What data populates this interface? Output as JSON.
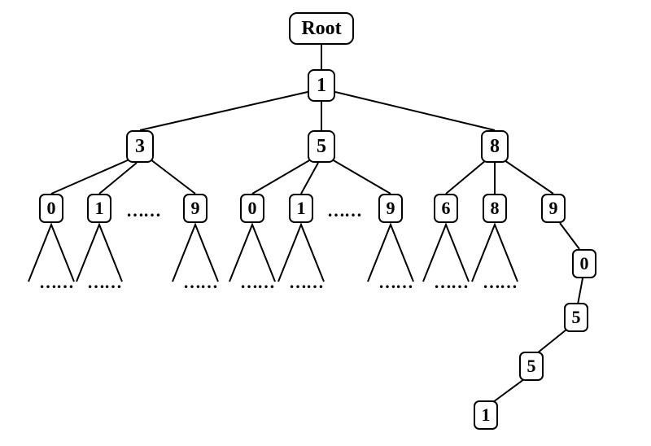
{
  "tree": {
    "root": "Root",
    "l1": {
      "n1": "1"
    },
    "l2": {
      "n3": "3",
      "n5": "5",
      "n8": "8"
    },
    "l3": {
      "a": {
        "c0": "0",
        "c1": "1",
        "c9": "9"
      },
      "b": {
        "c0": "0",
        "c1": "1",
        "c9": "9"
      },
      "c": {
        "c6": "6",
        "c8": "8",
        "c9": "9"
      }
    },
    "tail": {
      "t0": "0",
      "t5a": "5",
      "t5b": "5",
      "t1": "1"
    }
  },
  "dots": "……",
  "chart_data": {
    "type": "tree",
    "title": "",
    "description": "digit trie / prefix tree rooted at Root → 1, children 3/5/8, each with digit children 0..9; branch 1-8-9-0-5-5-1 shown explicitly.",
    "nodes": [
      {
        "id": "root",
        "label": "Root",
        "parent": null
      },
      {
        "id": "n1",
        "label": "1",
        "parent": "root"
      },
      {
        "id": "n3",
        "label": "3",
        "parent": "n1"
      },
      {
        "id": "n5",
        "label": "5",
        "parent": "n1"
      },
      {
        "id": "n8",
        "label": "8",
        "parent": "n1"
      },
      {
        "id": "a0",
        "label": "0",
        "parent": "n3"
      },
      {
        "id": "a1",
        "label": "1",
        "parent": "n3"
      },
      {
        "id": "a_ellipsis",
        "label": "…",
        "parent": "n3",
        "ellipsis": true
      },
      {
        "id": "a9",
        "label": "9",
        "parent": "n3"
      },
      {
        "id": "b0",
        "label": "0",
        "parent": "n5"
      },
      {
        "id": "b1",
        "label": "1",
        "parent": "n5"
      },
      {
        "id": "b_ellipsis",
        "label": "…",
        "parent": "n5",
        "ellipsis": true
      },
      {
        "id": "b9",
        "label": "9",
        "parent": "n5"
      },
      {
        "id": "c6",
        "label": "6",
        "parent": "n8"
      },
      {
        "id": "c8",
        "label": "8",
        "parent": "n8"
      },
      {
        "id": "c9",
        "label": "9",
        "parent": "n8"
      },
      {
        "id": "t0",
        "label": "0",
        "parent": "c9"
      },
      {
        "id": "t5a",
        "label": "5",
        "parent": "t0"
      },
      {
        "id": "t5b",
        "label": "5",
        "parent": "t5a"
      },
      {
        "id": "t1",
        "label": "1",
        "parent": "t5b"
      }
    ],
    "subtree_placeholders": [
      "a0",
      "a1",
      "a9",
      "b0",
      "b1",
      "b9",
      "c6",
      "c8"
    ]
  }
}
